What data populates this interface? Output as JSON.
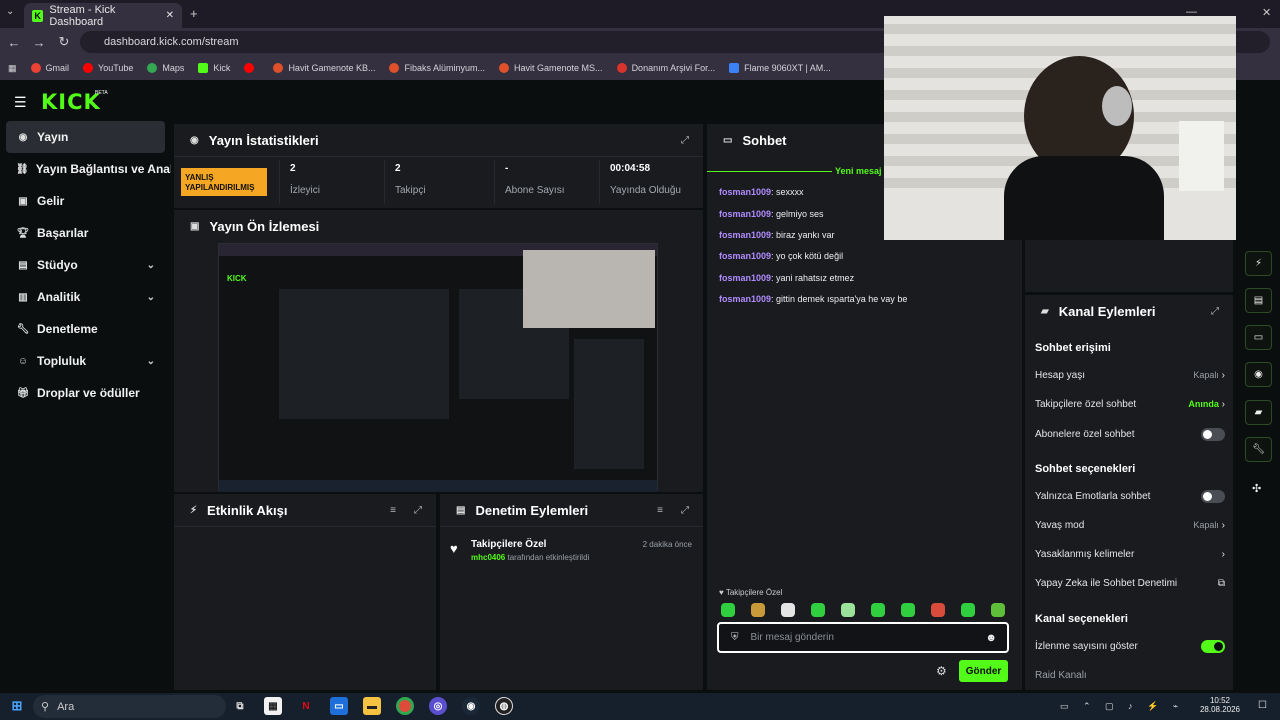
{
  "browser": {
    "tab_title": "Stream - Kick Dashboard",
    "url": "dashboard.kick.com/stream",
    "bookmarks": [
      "Gmail",
      "YouTube",
      "Maps",
      "Kick",
      "",
      "Havit Gamenote KB...",
      "Fibaks Alüminyum...",
      "Havit Gamenote MS...",
      "Donanım Arşivi For...",
      "Flame 9060XT | AM..."
    ]
  },
  "app": {
    "logo": "KICK",
    "beta": "BETA"
  },
  "sidebar": {
    "items": [
      "Yayın",
      "Yayın Bağlantısı ve Anahtarı",
      "Gelir",
      "Başarılar",
      "Stüdyo",
      "Analitik",
      "Denetleme",
      "Topluluk",
      "Droplar ve ödüller"
    ]
  },
  "stats": {
    "title": "Yayın İstatistikleri",
    "badge": "YANLIŞ YAPILANDIRILMIŞ",
    "viewers_value": "2",
    "viewers_label": "İzleyici",
    "followers_value": "2",
    "followers_label": "Takipçi",
    "subs_value": "-",
    "subs_label": "Abone Sayısı",
    "uptime_value": "00:04:58",
    "uptime_label": "Yayında Olduğu"
  },
  "preview": {
    "title": "Yayın Ön İzlemesi"
  },
  "activity": {
    "title": "Etkinlik Akışı"
  },
  "moderation": {
    "title": "Denetim Eylemleri",
    "item_title": "Takipçilere Özel",
    "item_time": "2 dakika önce",
    "item_user": "mhc0406",
    "item_desc": "tarafından etkinleştirildi"
  },
  "chat": {
    "title": "Sohbet",
    "new_messages": "Yeni mesaj",
    "messages": [
      {
        "user": "fosman1009",
        "text": ": sexxxx"
      },
      {
        "user": "fosman1009",
        "text": ": gelmiyo ses"
      },
      {
        "user": "fosman1009",
        "text": ": biraz yankı var"
      },
      {
        "user": "fosman1009",
        "text": ": yo çok kötü değil"
      },
      {
        "user": "fosman1009",
        "text": ": yani rahatsız etmez"
      },
      {
        "user": "fosman1009",
        "text": ": gittin demek ısparta'ya he vay be"
      }
    ],
    "mode_label": "Takipçilere Özel",
    "placeholder": "Bir mesaj gönderin",
    "send": "Gönder"
  },
  "channel": {
    "title": "Kanal Eylemleri",
    "chat_access": "Sohbet erişimi",
    "account_age": "Hesap yaşı",
    "account_age_value": "Kapalı",
    "followers_only": "Takipçilere özel sohbet",
    "followers_only_value": "Anında",
    "subs_only": "Abonelere özel sohbet",
    "chat_options": "Sohbet seçenekleri",
    "emotes_only": "Yalnızca Emotlarla sohbet",
    "slow_mode": "Yavaş mod",
    "slow_mode_value": "Kapalı",
    "banned_words": "Yasaklanmış kelimeler",
    "ai_mod": "Yapay Zeka ile Sohbet Denetimi",
    "channel_options": "Kanal seçenekleri",
    "show_views": "İzlenme sayısını göster",
    "raid": "Raid Kanalı"
  },
  "taskbar": {
    "search": "Ara",
    "time": "10:52",
    "date": "28.08.2026"
  },
  "colors": {
    "accent": "#53fc18",
    "badge": "#f5a623",
    "username": "#b18cff"
  }
}
